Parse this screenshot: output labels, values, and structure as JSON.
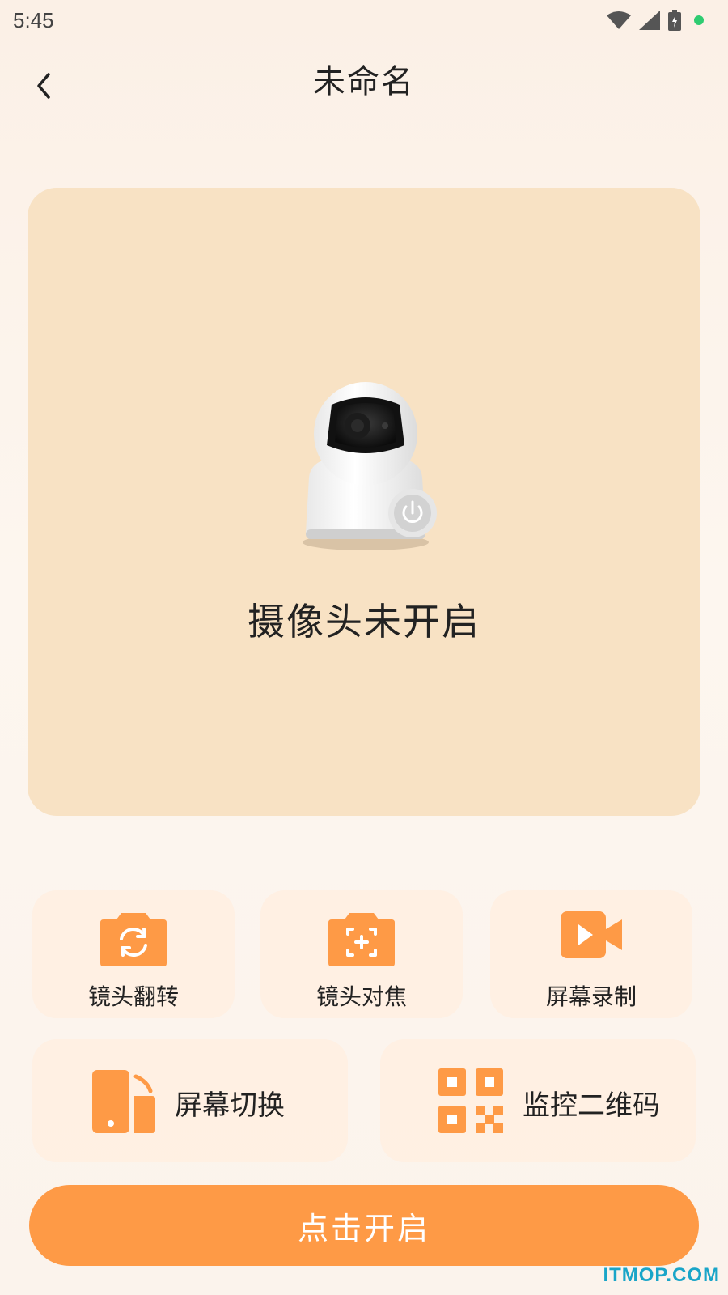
{
  "status_bar": {
    "time": "5:45"
  },
  "header": {
    "title": "未命名"
  },
  "preview": {
    "status_text": "摄像头未开启"
  },
  "tools": [
    {
      "label": "镜头翻转",
      "icon": "camera-flip-icon"
    },
    {
      "label": "镜头对焦",
      "icon": "camera-focus-icon"
    },
    {
      "label": "屏幕录制",
      "icon": "video-record-icon"
    }
  ],
  "tools_wide": [
    {
      "label": "屏幕切换",
      "icon": "screen-switch-icon"
    },
    {
      "label": "监控二维码",
      "icon": "qr-code-icon"
    }
  ],
  "primary_button": {
    "label": "点击开启"
  },
  "watermark": "ITMOP.COM",
  "colors": {
    "accent": "#fe9a46",
    "panel": "#f8e2c4",
    "card": "#ffeee0"
  }
}
